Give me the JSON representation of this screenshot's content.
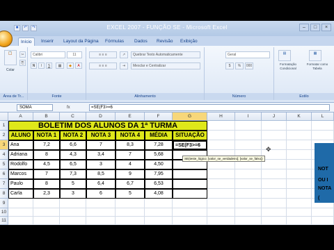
{
  "window": {
    "title": "EXCEL 2007 - FUNÇÃO SE - Microsoft Excel",
    "controls": [
      "–",
      "□",
      "×"
    ]
  },
  "tabs": [
    "Início",
    "Inserir",
    "Layout da Página",
    "Fórmulas",
    "Dados",
    "Revisão",
    "Exibição"
  ],
  "ribbon": {
    "paste": "Colar",
    "font": "Calibri",
    "font_size": "11",
    "wrap": "Quebrar Texto Automaticamente",
    "merge": "Mesclar e Centralizar",
    "number_format": "Geral",
    "cond_format": "Formatação Condicional",
    "format_table": "Formatar como Tabela",
    "groups": [
      "Área de Tr...",
      "Fonte",
      "Alinhamento",
      "Número",
      "Estilo"
    ]
  },
  "formula_bar": {
    "name_box": "SOMA",
    "fx": "fx",
    "content": "=SE(F3>=6"
  },
  "columns": [
    "A",
    "B",
    "C",
    "D",
    "E",
    "F",
    "G",
    "H",
    "I",
    "J",
    "K",
    "L"
  ],
  "rows": [
    "1",
    "2",
    "3",
    "4",
    "5",
    "6",
    "7",
    "8",
    "9",
    "10",
    "11"
  ],
  "sheet": {
    "title": "BOLETIM DOS ALUNOS DA 1ª TURMA",
    "headers": [
      "ALUNO",
      "NOTA 1",
      "NOTA 2",
      "NOTA 3",
      "NOTA 4",
      "MÉDIA",
      "SITUAÇÃO"
    ],
    "students": [
      {
        "name": "Ana",
        "n1": "7,2",
        "n2": "6,6",
        "n3": "7",
        "n4": "8,3",
        "avg": "7,28",
        "sit": "=SE(F3>=6"
      },
      {
        "name": "Adriana",
        "n1": "8",
        "n2": "4,3",
        "n3": "3,4",
        "n4": "7",
        "avg": "5,68",
        "sit": ""
      },
      {
        "name": "Rodolfo",
        "n1": "4,5",
        "n2": "6,5",
        "n3": "3",
        "n4": "4",
        "avg": "4,50",
        "sit": ""
      },
      {
        "name": "Marcos",
        "n1": "7",
        "n2": "7,3",
        "n3": "8,5",
        "n4": "9",
        "avg": "7,95",
        "sit": ""
      },
      {
        "name": "Paulo",
        "n1": "8",
        "n2": "5",
        "n3": "6,4",
        "n4": "6,7",
        "avg": "6,53",
        "sit": ""
      },
      {
        "name": "Carla",
        "n1": "2,3",
        "n2": "3",
        "n3": "6",
        "n4": "5",
        "avg": "4,08",
        "sit": ""
      }
    ]
  },
  "tooltip": "SE(teste_lógico; [valor_se_verdadeiro]; [valor_se_falso])",
  "right_panel": {
    "lines": [
      "NOT",
      "OU I",
      "NOTA",
      "("
    ]
  },
  "colors": {
    "header_fill": "#dfe81a",
    "panel": "#1f6aa8"
  }
}
